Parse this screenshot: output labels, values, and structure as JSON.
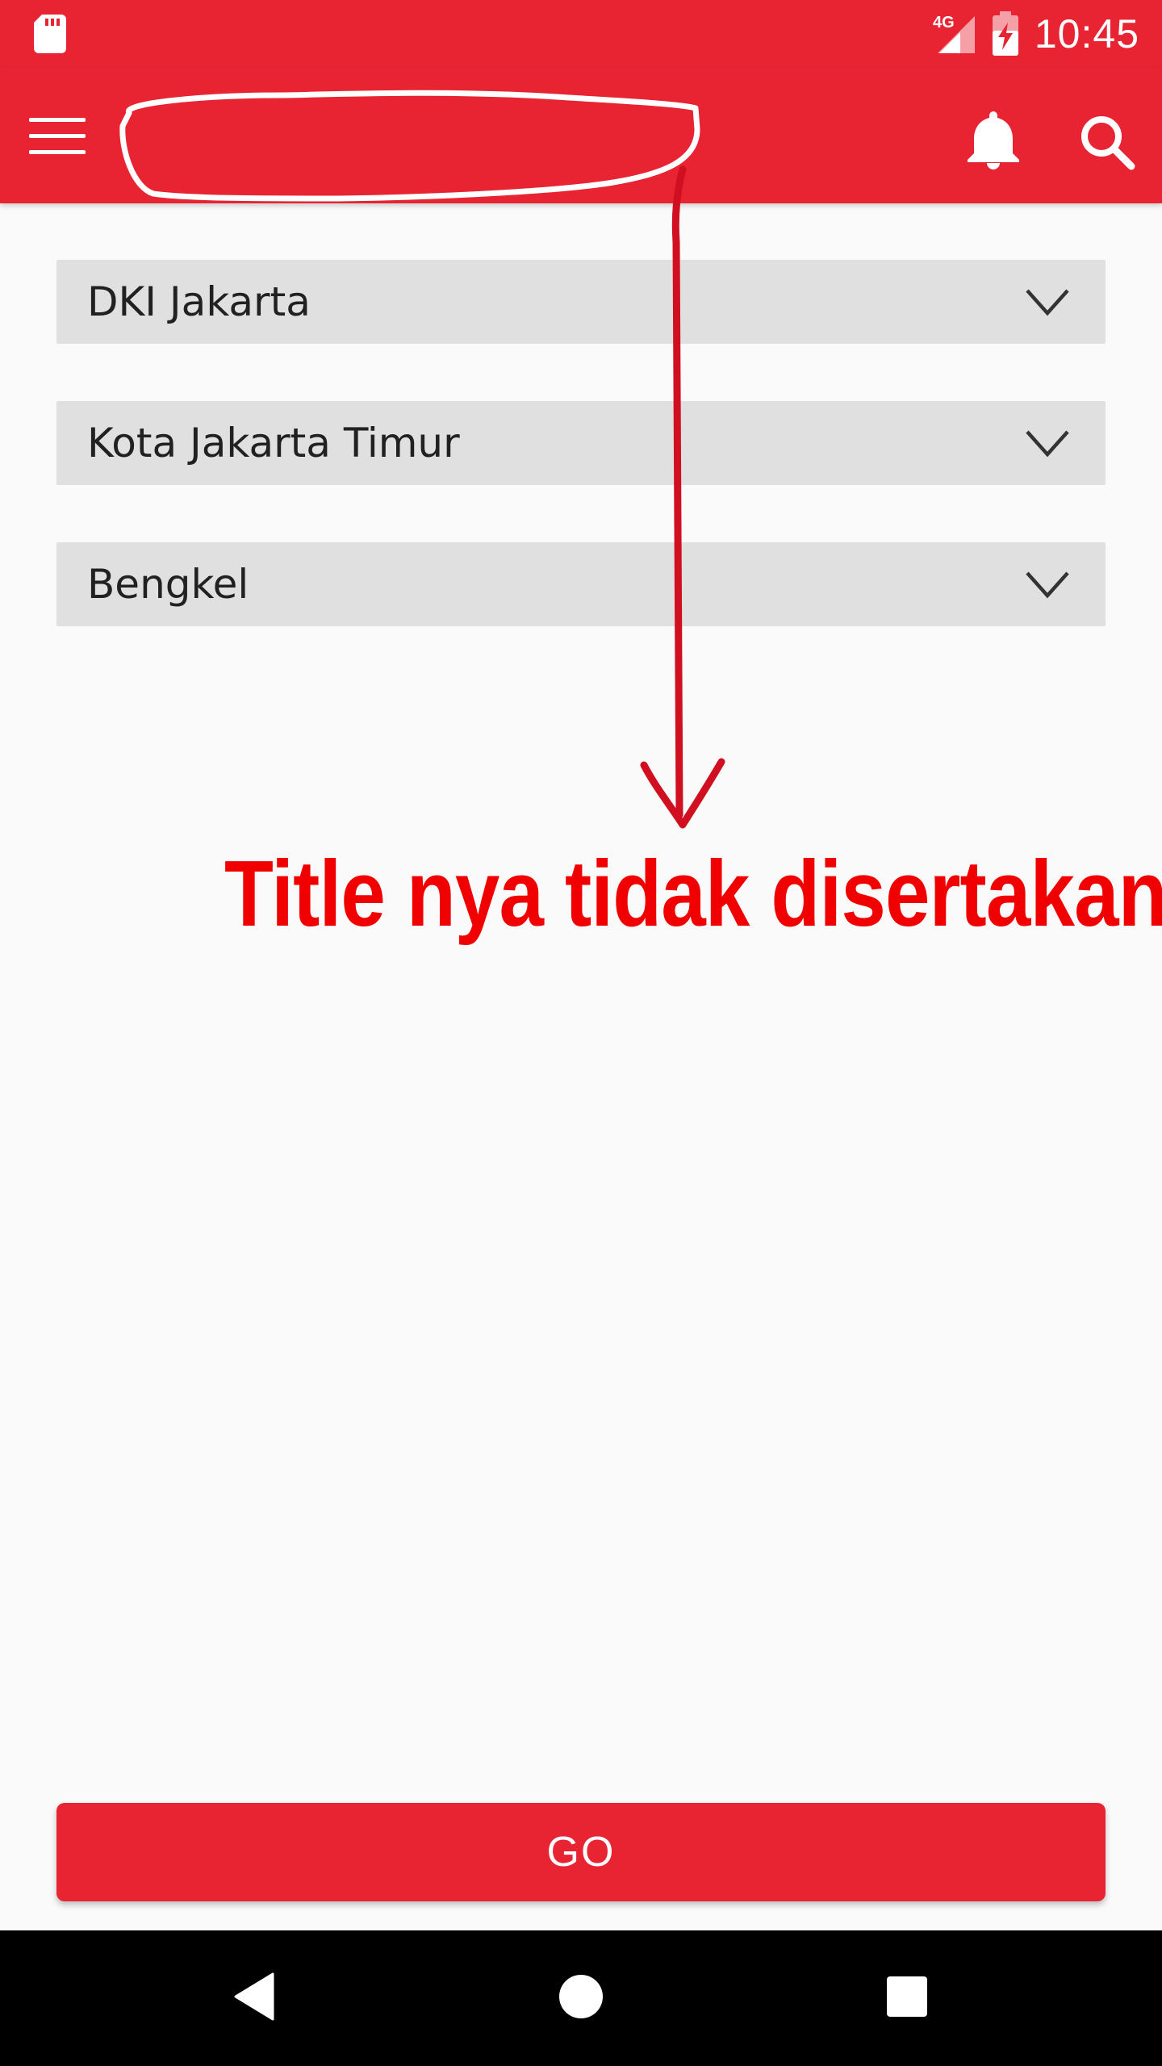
{
  "status_bar": {
    "time": "10:45",
    "network": "4G",
    "icons": [
      "sd-card-icon",
      "signal-4g-icon",
      "battery-charging-icon"
    ]
  },
  "app_bar": {
    "title": "",
    "icons": [
      "menu-icon",
      "bell-icon",
      "search-icon"
    ]
  },
  "dropdowns": [
    {
      "name": "province",
      "selected": "DKI Jakarta"
    },
    {
      "name": "city",
      "selected": "Kota Jakarta Timur"
    },
    {
      "name": "category",
      "selected": "Bengkel"
    }
  ],
  "annotation": {
    "text": "Title nya tidak  disertakan"
  },
  "go_button": {
    "label": "GO"
  },
  "nav_bar": {
    "icons": [
      "back-icon",
      "home-icon",
      "recents-icon"
    ]
  },
  "colors": {
    "primary": "#E82433",
    "dropdown_bg": "#E0E0E0",
    "background": "#FAFAFA",
    "annotation_red": "#F00000",
    "annotation_arrow": "#D01020",
    "annotation_outline": "#FFFFFF"
  }
}
